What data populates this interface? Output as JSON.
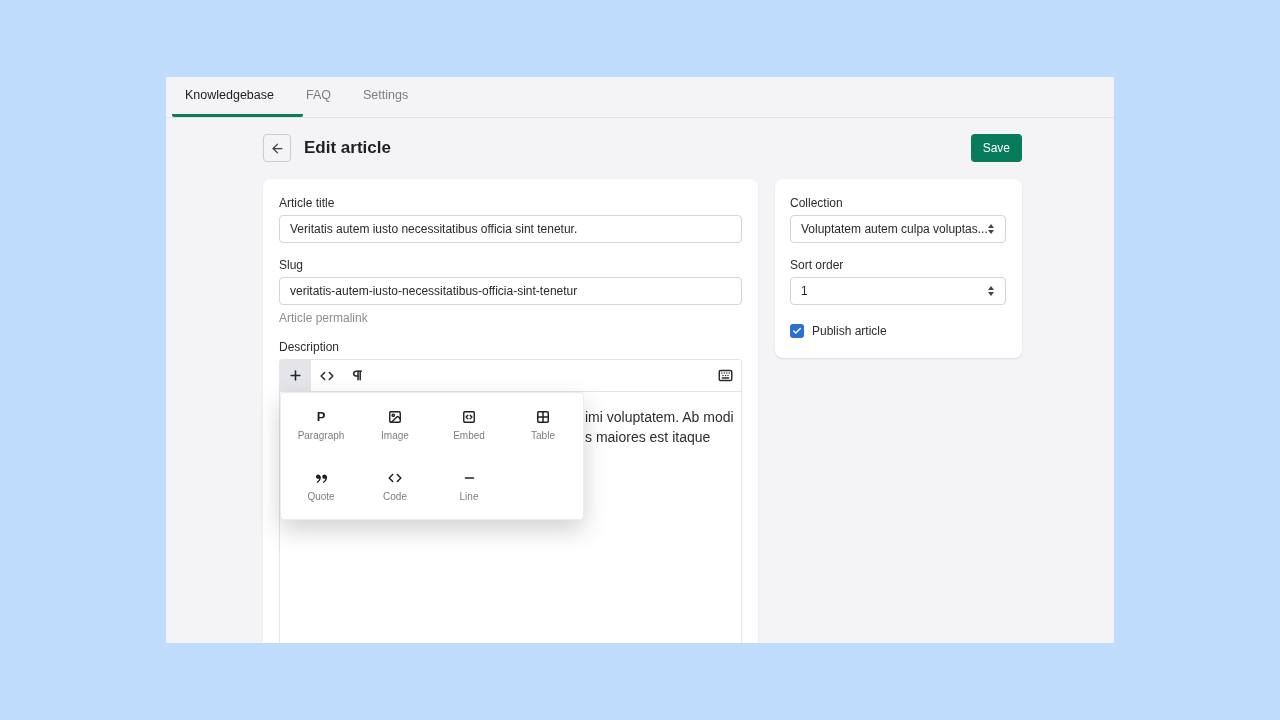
{
  "tabs": [
    {
      "label": "Knowledgebase",
      "selected": true
    },
    {
      "label": "FAQ",
      "selected": false
    },
    {
      "label": "Settings",
      "selected": false
    }
  ],
  "header": {
    "title": "Edit article",
    "save_button": "Save"
  },
  "article": {
    "fields": [
      {
        "label": "Article title",
        "value": "Veritatis autem iusto necessitatibus officia sint tenetur."
      },
      {
        "label": "Slug",
        "value": "veritatis-autem-iusto-necessitatibus-officia-sint-tenetur",
        "help": "Article permalink"
      }
    ],
    "description": {
      "label": "Description",
      "toolbar": [
        {
          "kind": "add",
          "selected": true
        },
        {
          "kind": "code",
          "selected": false
        },
        {
          "kind": "paragraph",
          "selected": false
        },
        {
          "kind": "keyboard",
          "selected": false
        }
      ],
      "text_lines": [
        "imi voluptatem. Ab modi",
        "s maiores est itaque"
      ],
      "insert_menu": {
        "open": true,
        "items": [
          {
            "kind": "paragraph",
            "glyph": "P",
            "label": "Paragraph"
          },
          {
            "kind": "image",
            "label": "Image"
          },
          {
            "kind": "embed",
            "label": "Embed"
          },
          {
            "kind": "table",
            "label": "Table"
          },
          {
            "kind": "quote",
            "label": "Quote"
          },
          {
            "kind": "code",
            "label": "Code"
          },
          {
            "kind": "line",
            "label": "Line"
          }
        ]
      }
    }
  },
  "settings": {
    "collection": {
      "label": "Collection",
      "value": "Voluptatem autem culpa voluptas..."
    },
    "sort_order": {
      "label": "Sort order",
      "value": "1"
    },
    "publish": {
      "label": "Publish article",
      "checked": true
    }
  }
}
